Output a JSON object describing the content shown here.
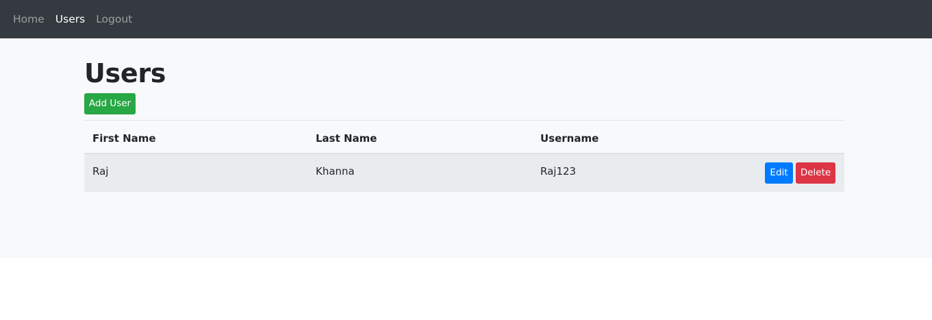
{
  "navbar": {
    "items": [
      {
        "label": "Home",
        "active": false
      },
      {
        "label": "Users",
        "active": true
      },
      {
        "label": "Logout",
        "active": false
      }
    ]
  },
  "page": {
    "title": "Users",
    "add_button_label": "Add User"
  },
  "table": {
    "headers": [
      "First Name",
      "Last Name",
      "Username"
    ],
    "rows": [
      {
        "first_name": "Raj",
        "last_name": "Khanna",
        "username": "Raj123",
        "edit_label": "Edit",
        "delete_label": "Delete"
      }
    ]
  },
  "colors": {
    "navbar_bg": "#343a40",
    "success": "#28a745",
    "primary": "#007bff",
    "danger": "#dc3545",
    "page_bg": "#f8f9fa"
  }
}
